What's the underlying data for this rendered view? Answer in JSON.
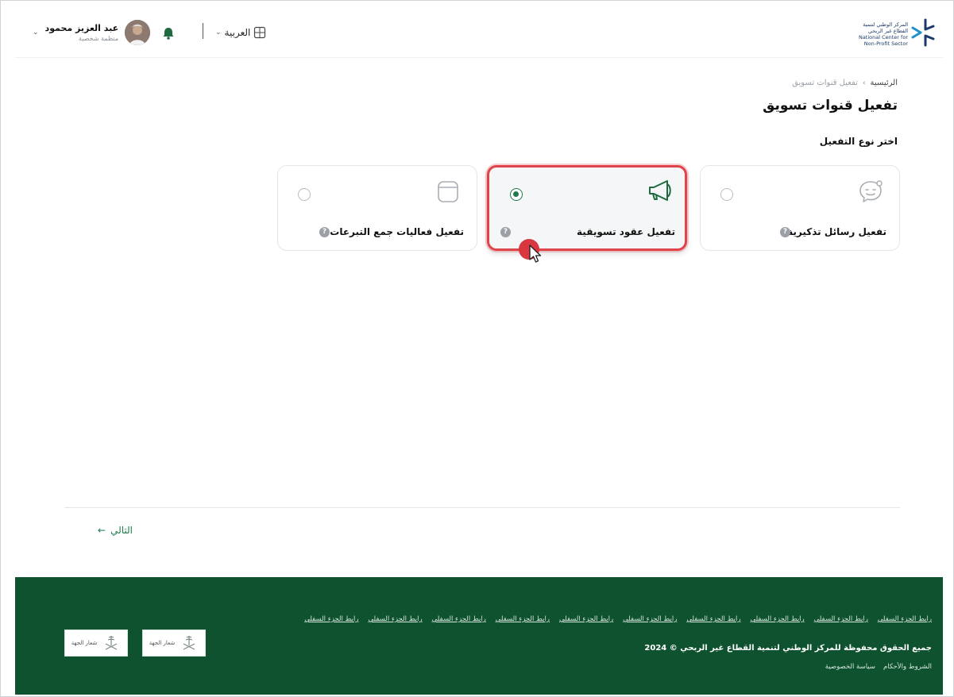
{
  "header": {
    "logo": {
      "line1": "المركز الوطني لتنمية",
      "line2": "القطاع غير الربحي",
      "line3": "National Center for",
      "line4": "Non-Profit Sector"
    },
    "language": {
      "label": "العربية"
    },
    "user": {
      "name": "عبد العزيز محمود",
      "role": "منظمة شخصية"
    }
  },
  "breadcrumb": {
    "home": "الرئيسية",
    "separator": "›",
    "current": "تفعيل قنوات تسويق"
  },
  "page": {
    "title": "تفعيل قنوات تسويق",
    "section_label": "اختر نوع التفعيل"
  },
  "cards": [
    {
      "label": "تفعيل رسائل تذكيرية",
      "selected": false,
      "icon": "chat-bubble-icon"
    },
    {
      "label": "تفعيل عقود تسويقية",
      "selected": true,
      "icon": "megaphone-icon"
    },
    {
      "label": "تفعيل فعاليات جمع التبرعات",
      "selected": false,
      "icon": "calendar-icon"
    }
  ],
  "info_glyph": "?",
  "next": {
    "label": "التالي",
    "arrow": "←"
  },
  "footer": {
    "links": [
      "رابط الجزء السفلي",
      "رابط الجزء السفلي",
      "رابط الجزء السفلي",
      "رابط الجزء السفلي",
      "رابط الجزء السفلي",
      "رابط الجزء السفلي",
      "رابط الجزء السفلي",
      "رابط الجزء السفلي",
      "رابط الجزء السفلي",
      "رابط الجزء السفلي"
    ],
    "copyright": "جميع الحقوق محفوظة للمركز الوطني لتنمية القطاع غير الربحي © 2024",
    "terms": "الشروط والأحكام",
    "privacy": "سياسة الخصوصية",
    "emblem_label_1": "شعار الجهة",
    "emblem_label_2": "شعار الجهة"
  },
  "colors": {
    "brand_green": "#0f5230",
    "accent_green": "#1e7a4b",
    "highlight_red": "#e0444b"
  }
}
